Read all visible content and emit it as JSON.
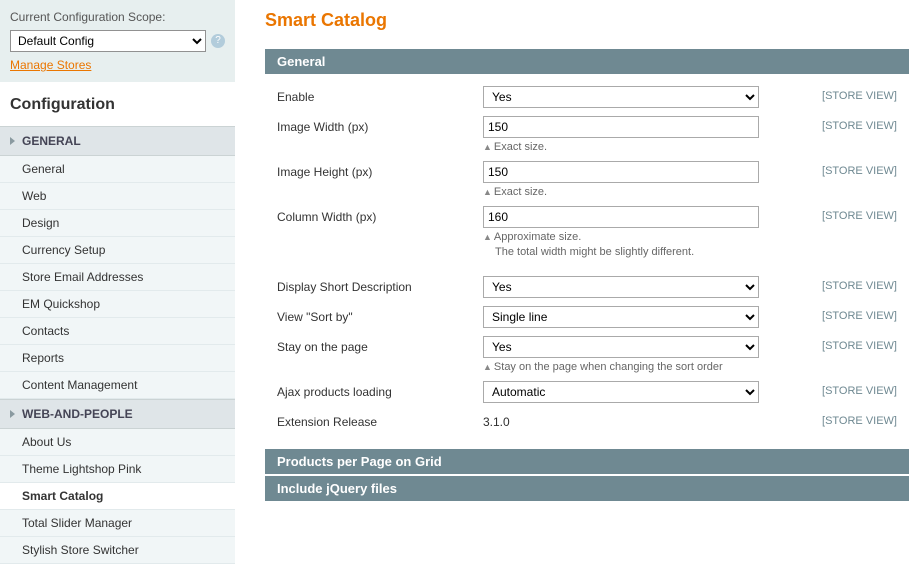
{
  "scope": {
    "label": "Current Configuration Scope:",
    "value": "Default Config",
    "help": "?",
    "manage": "Manage Stores"
  },
  "config_title": "Configuration",
  "sections": [
    {
      "head": "GENERAL",
      "items": [
        "General",
        "Web",
        "Design",
        "Currency Setup",
        "Store Email Addresses",
        "EM Quickshop",
        "Contacts",
        "Reports",
        "Content Management"
      ]
    },
    {
      "head": "WEB-AND-PEOPLE",
      "items": [
        "About Us",
        "Theme Lightshop Pink",
        "Smart Catalog",
        "Total Slider Manager",
        "Stylish Store Switcher"
      ],
      "active": "Smart Catalog"
    }
  ],
  "page_title": "Smart Catalog",
  "fieldsets": {
    "general": {
      "head": "General",
      "fields": {
        "enable": {
          "label": "Enable",
          "value": "Yes",
          "scope": "[STORE VIEW]"
        },
        "img_w": {
          "label": "Image Width (px)",
          "value": "150",
          "note": "Exact size.",
          "scope": "[STORE VIEW]"
        },
        "img_h": {
          "label": "Image Height (px)",
          "value": "150",
          "note": "Exact size.",
          "scope": "[STORE VIEW]"
        },
        "col_w": {
          "label": "Column Width (px)",
          "value": "160",
          "note": "Approximate size.",
          "note2": "The total width might be slightly different.",
          "scope": "[STORE VIEW]"
        },
        "short": {
          "label": "Display Short Description",
          "value": "Yes",
          "scope": "[STORE VIEW]"
        },
        "sortby": {
          "label": "View \"Sort by\"",
          "value": "Single line",
          "scope": "[STORE VIEW]"
        },
        "stay": {
          "label": "Stay on the page",
          "value": "Yes",
          "note": "Stay on the page when changing the sort order",
          "scope": "[STORE VIEW]"
        },
        "ajax": {
          "label": "Ajax products loading",
          "value": "Automatic",
          "scope": "[STORE VIEW]"
        },
        "release": {
          "label": "Extension Release",
          "value": "3.1.0",
          "scope": "[STORE VIEW]"
        }
      }
    },
    "grid": {
      "head": "Products per Page on Grid"
    },
    "jquery": {
      "head": "Include jQuery files"
    }
  }
}
